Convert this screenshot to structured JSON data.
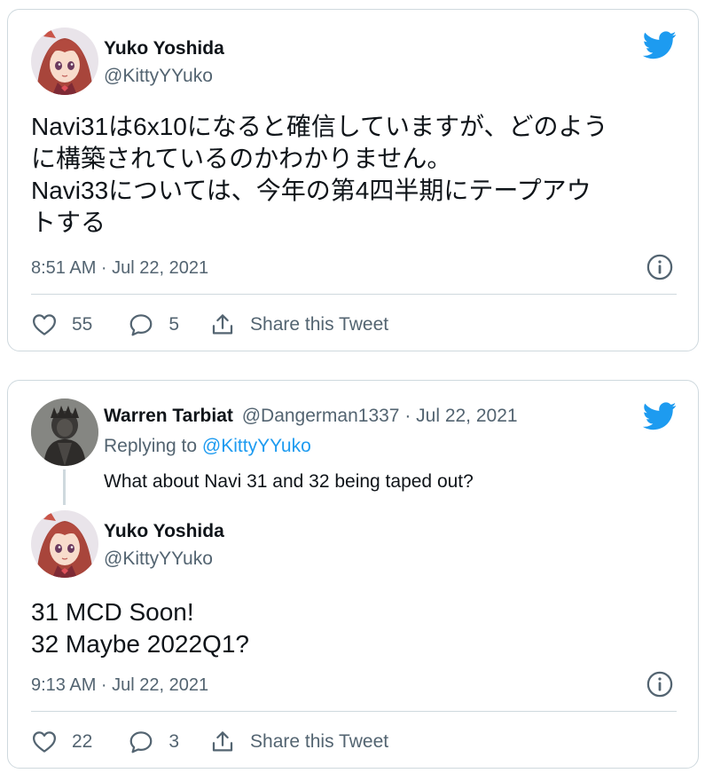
{
  "tweet1": {
    "author_name": "Yuko Yoshida",
    "author_handle": "@KittyYYuko",
    "lines": [
      "Navi31は6x10になると確信していますが、どのよう",
      "に構築されているのかわかりません。",
      "Navi33については、今年の第4四半期にテープアウ",
      "トする"
    ],
    "timestamp": "8:51 AM · Jul 22, 2021",
    "likes": "55",
    "replies": "5",
    "share_label": "Share this Tweet"
  },
  "tweet2": {
    "parent": {
      "author_name": "Warren Tarbiat",
      "author_handle_date": "@Dangerman1337 · Jul 22, 2021",
      "replying_prefix": "Replying to ",
      "replying_handle": "@KittyYYuko",
      "text": "What about Navi 31 and 32 being taped out?"
    },
    "author_name": "Yuko Yoshida",
    "author_handle": "@KittyYYuko",
    "lines": [
      "31 MCD Soon!",
      "32 Maybe 2022Q1?"
    ],
    "timestamp": "9:13 AM · Jul 22, 2021",
    "likes": "22",
    "replies": "3",
    "share_label": "Share this Tweet"
  },
  "colors": {
    "twitter_blue": "#1d9bf0",
    "secondary_text": "#536471",
    "border": "#cfd9de"
  },
  "icons": [
    "twitter-bird-icon",
    "info-icon",
    "heart-icon",
    "reply-bubble-icon",
    "share-icon"
  ]
}
